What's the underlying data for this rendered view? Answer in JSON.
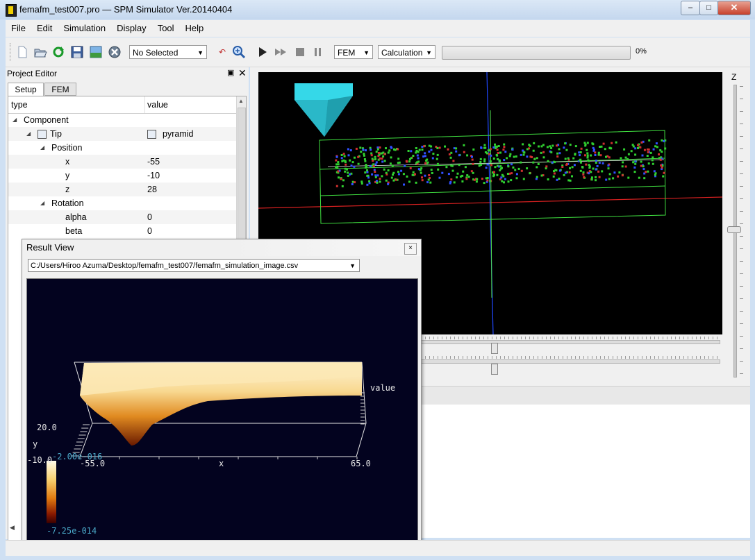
{
  "window": {
    "title": "femafm_test007.pro — SPM Simulator Ver.20140404",
    "btn_min": "‒",
    "btn_max": "□",
    "btn_close": "✕"
  },
  "menu": [
    "File",
    "Edit",
    "Simulation",
    "Display",
    "Tool",
    "Help"
  ],
  "toolbar": {
    "icons": [
      "new-file-icon",
      "open-folder-icon",
      "refresh-icon",
      "save-icon",
      "image-icon",
      "close-circle-icon",
      "undo-icon",
      "zoom-icon",
      "play-icon",
      "fast-forward-icon",
      "stop-icon",
      "pause-icon"
    ],
    "selection": "No Selected",
    "mode": "FEM",
    "action": "Calculation",
    "progress_value": 0,
    "progress_text": "0%"
  },
  "project_editor": {
    "title": "Project Editor",
    "float_icon": "▣",
    "close_icon": "✕",
    "tabs": [
      "Setup",
      "FEM"
    ],
    "headers": [
      "type",
      "value"
    ],
    "rows": [
      {
        "indent": 0,
        "toggle": "◢",
        "label": "Component",
        "value": ""
      },
      {
        "indent": 1,
        "toggle": "◢",
        "label": "Tip",
        "value": "pyramid",
        "icon": true
      },
      {
        "indent": 2,
        "toggle": "◢",
        "label": "Position",
        "value": ""
      },
      {
        "indent": 3,
        "toggle": "",
        "label": "x",
        "value": "-55"
      },
      {
        "indent": 3,
        "toggle": "",
        "label": "y",
        "value": "-10"
      },
      {
        "indent": 3,
        "toggle": "",
        "label": "z",
        "value": "28"
      },
      {
        "indent": 2,
        "toggle": "◢",
        "label": "Rotation",
        "value": ""
      },
      {
        "indent": 3,
        "toggle": "",
        "label": "alpha",
        "value": "0"
      },
      {
        "indent": 3,
        "toggle": "",
        "label": "beta",
        "value": "0"
      }
    ]
  },
  "view3d": {
    "z_label": "Z",
    "z_slider_value": 0.5,
    "h_slider_1": 0.25,
    "h_slider_2": 0.25
  },
  "result_view": {
    "title": "Result View",
    "close": "×",
    "file": "C:/Users/Hiroo Azuma/Desktop/femafm_test007/femafm_simulation_image.csv",
    "plot": {
      "z_label": "value",
      "y_label": "y",
      "x_label": "x",
      "x_min": "-55.0",
      "x_max": "65.0",
      "y_max": "20.0",
      "y_min": "-10.0",
      "scale_max": "-2.00e-016",
      "scale_min": "-7.25e-014"
    }
  },
  "colors": {
    "tip": "#35d8e8",
    "x_axis": "#e02020",
    "y_axis": "#2060ff",
    "box": "#40e040",
    "plot_bg": "#03031f"
  }
}
